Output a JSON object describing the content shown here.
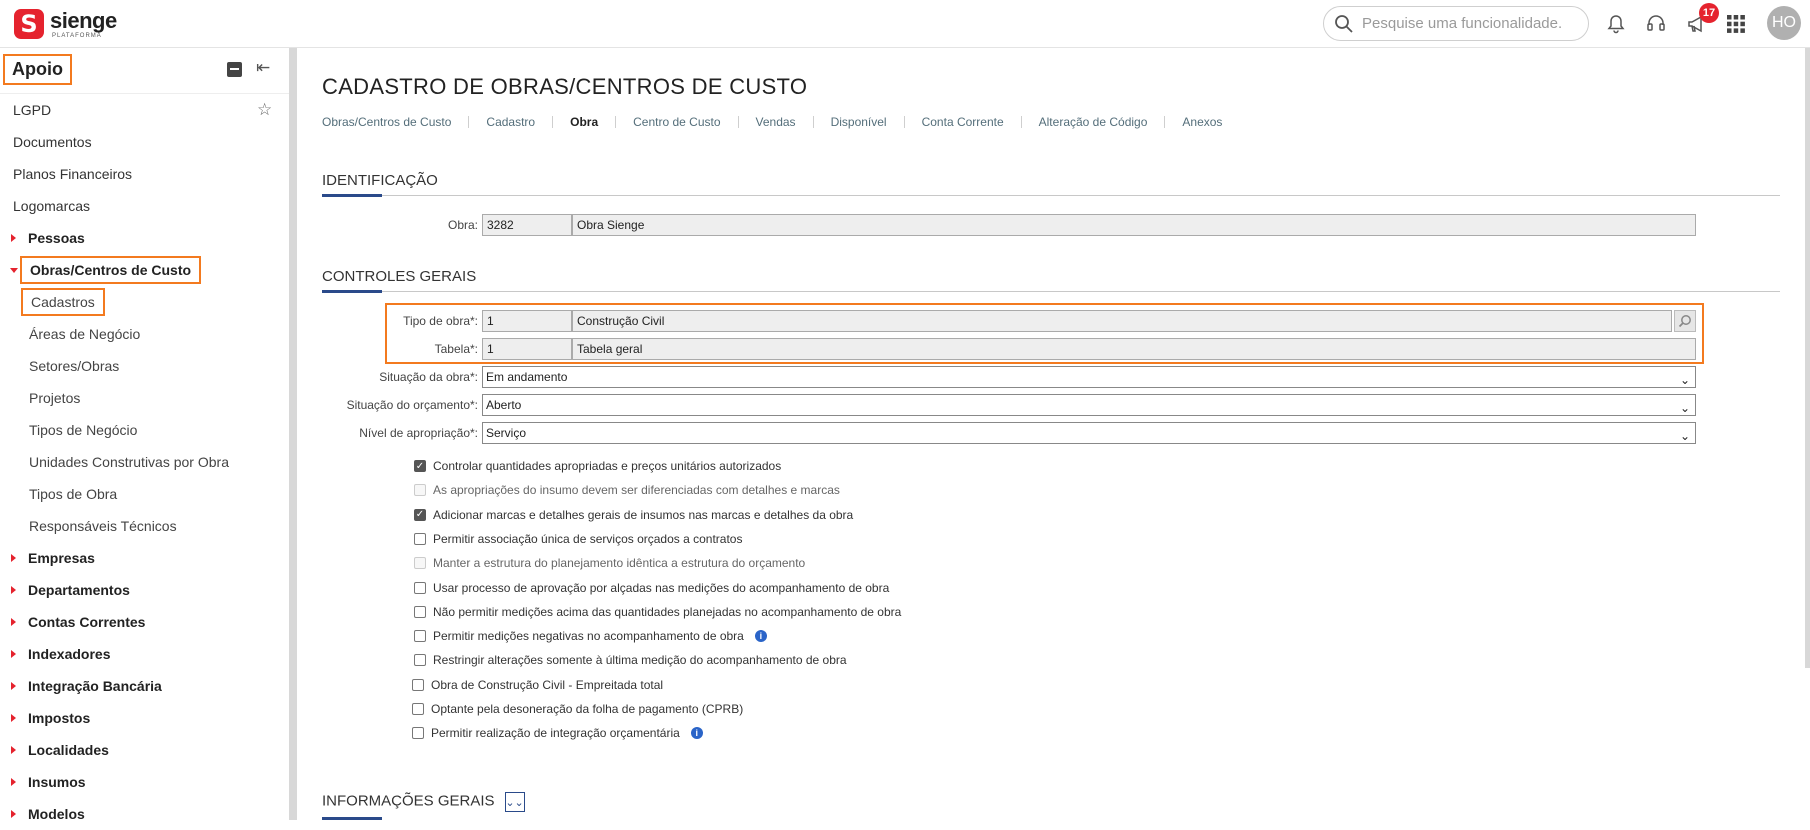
{
  "app": {
    "logo_letter": "S",
    "name": "sienge",
    "sub": "PLATAFORMA"
  },
  "search": {
    "placeholder": "Pesquise uma funcionalidade."
  },
  "notifications_badge": "17",
  "user_initials": "HO",
  "colors": {
    "brand": "#e5232e",
    "highlight": "#f37a1f",
    "section_accent": "#2a4a8a"
  },
  "sidebar": {
    "title": "Apoio",
    "items": [
      {
        "label": "LGPD",
        "type": "plain"
      },
      {
        "label": "Documentos",
        "type": "plain"
      },
      {
        "label": "Planos Financeiros",
        "type": "plain"
      },
      {
        "label": "Logomarcas",
        "type": "plain"
      },
      {
        "label": "Pessoas",
        "type": "group"
      },
      {
        "label": "Obras/Centros de Custo",
        "type": "group-open"
      },
      {
        "label": "Cadastros",
        "type": "sub"
      },
      {
        "label": "Áreas de Negócio",
        "type": "sub"
      },
      {
        "label": "Setores/Obras",
        "type": "sub"
      },
      {
        "label": "Projetos",
        "type": "sub"
      },
      {
        "label": "Tipos de Negócio",
        "type": "sub"
      },
      {
        "label": "Unidades Construtivas por Obra",
        "type": "sub"
      },
      {
        "label": "Tipos de Obra",
        "type": "sub"
      },
      {
        "label": "Responsáveis Técnicos",
        "type": "sub"
      },
      {
        "label": "Empresas",
        "type": "group"
      },
      {
        "label": "Departamentos",
        "type": "group"
      },
      {
        "label": "Contas Correntes",
        "type": "group"
      },
      {
        "label": "Indexadores",
        "type": "group"
      },
      {
        "label": "Integração Bancária",
        "type": "group"
      },
      {
        "label": "Impostos",
        "type": "group"
      },
      {
        "label": "Localidades",
        "type": "group"
      },
      {
        "label": "Insumos",
        "type": "group"
      },
      {
        "label": "Modelos",
        "type": "group"
      }
    ]
  },
  "main": {
    "title": "CADASTRO DE OBRAS/CENTROS DE CUSTO",
    "tabs": [
      "Obras/Centros de Custo",
      "Cadastro",
      "Obra",
      "Centro de Custo",
      "Vendas",
      "Disponível",
      "Conta Corrente",
      "Alteração de Código",
      "Anexos"
    ],
    "active_tab": "Obra",
    "sections": {
      "identificacao": "IDENTIFICAÇÃO",
      "controles": "CONTROLES GERAIS",
      "informacoes": "INFORMAÇÕES GERAIS"
    },
    "obra": {
      "label": "Obra:",
      "code": "3282",
      "name": "Obra Sienge"
    },
    "tipo_obra": {
      "label": "Tipo de obra*:",
      "code": "1",
      "name": "Construção Civil"
    },
    "tabela": {
      "label": "Tabela*:",
      "code": "1",
      "name": "Tabela geral"
    },
    "situacao_obra": {
      "label": "Situação da obra*:",
      "value": "Em andamento"
    },
    "situacao_orcamento": {
      "label": "Situação do orçamento*:",
      "value": "Aberto"
    },
    "nivel_apropriacao": {
      "label": "Nível de apropriação*:",
      "value": "Serviço"
    },
    "checkboxes": [
      {
        "label": "Controlar quantidades apropriadas e preços unitários autorizados",
        "checked": true,
        "disabled": false
      },
      {
        "label": "As apropriações do insumo devem ser diferenciadas com detalhes e marcas",
        "checked": false,
        "disabled": true
      },
      {
        "label": "Adicionar marcas e detalhes gerais de insumos nas marcas e detalhes da obra",
        "checked": true,
        "disabled": false
      },
      {
        "label": "Permitir associação única de serviços orçados a contratos",
        "checked": false,
        "disabled": false
      },
      {
        "label": "Manter a estrutura do planejamento idêntica a estrutura do orçamento",
        "checked": false,
        "disabled": true
      },
      {
        "label": "Usar processo de aprovação por alçadas nas medições do acompanhamento de obra",
        "checked": false,
        "disabled": false
      },
      {
        "label": "Não permitir medições acima das quantidades planejadas no acompanhamento de obra",
        "checked": false,
        "disabled": false
      },
      {
        "label": "Permitir medições negativas no acompanhamento de obra",
        "checked": false,
        "disabled": false,
        "info": true
      },
      {
        "label": "Restringir alterações somente à última medição do acompanhamento de obra",
        "checked": false,
        "disabled": false
      },
      {
        "label": "Obra de Construção Civil - Empreitada total",
        "checked": false,
        "disabled": false
      },
      {
        "label": "Optante pela desoneração da folha de pagamento (CPRB)",
        "checked": false,
        "disabled": false
      },
      {
        "label": "Permitir realização de integração orçamentária",
        "checked": false,
        "disabled": false,
        "info": true
      }
    ]
  }
}
